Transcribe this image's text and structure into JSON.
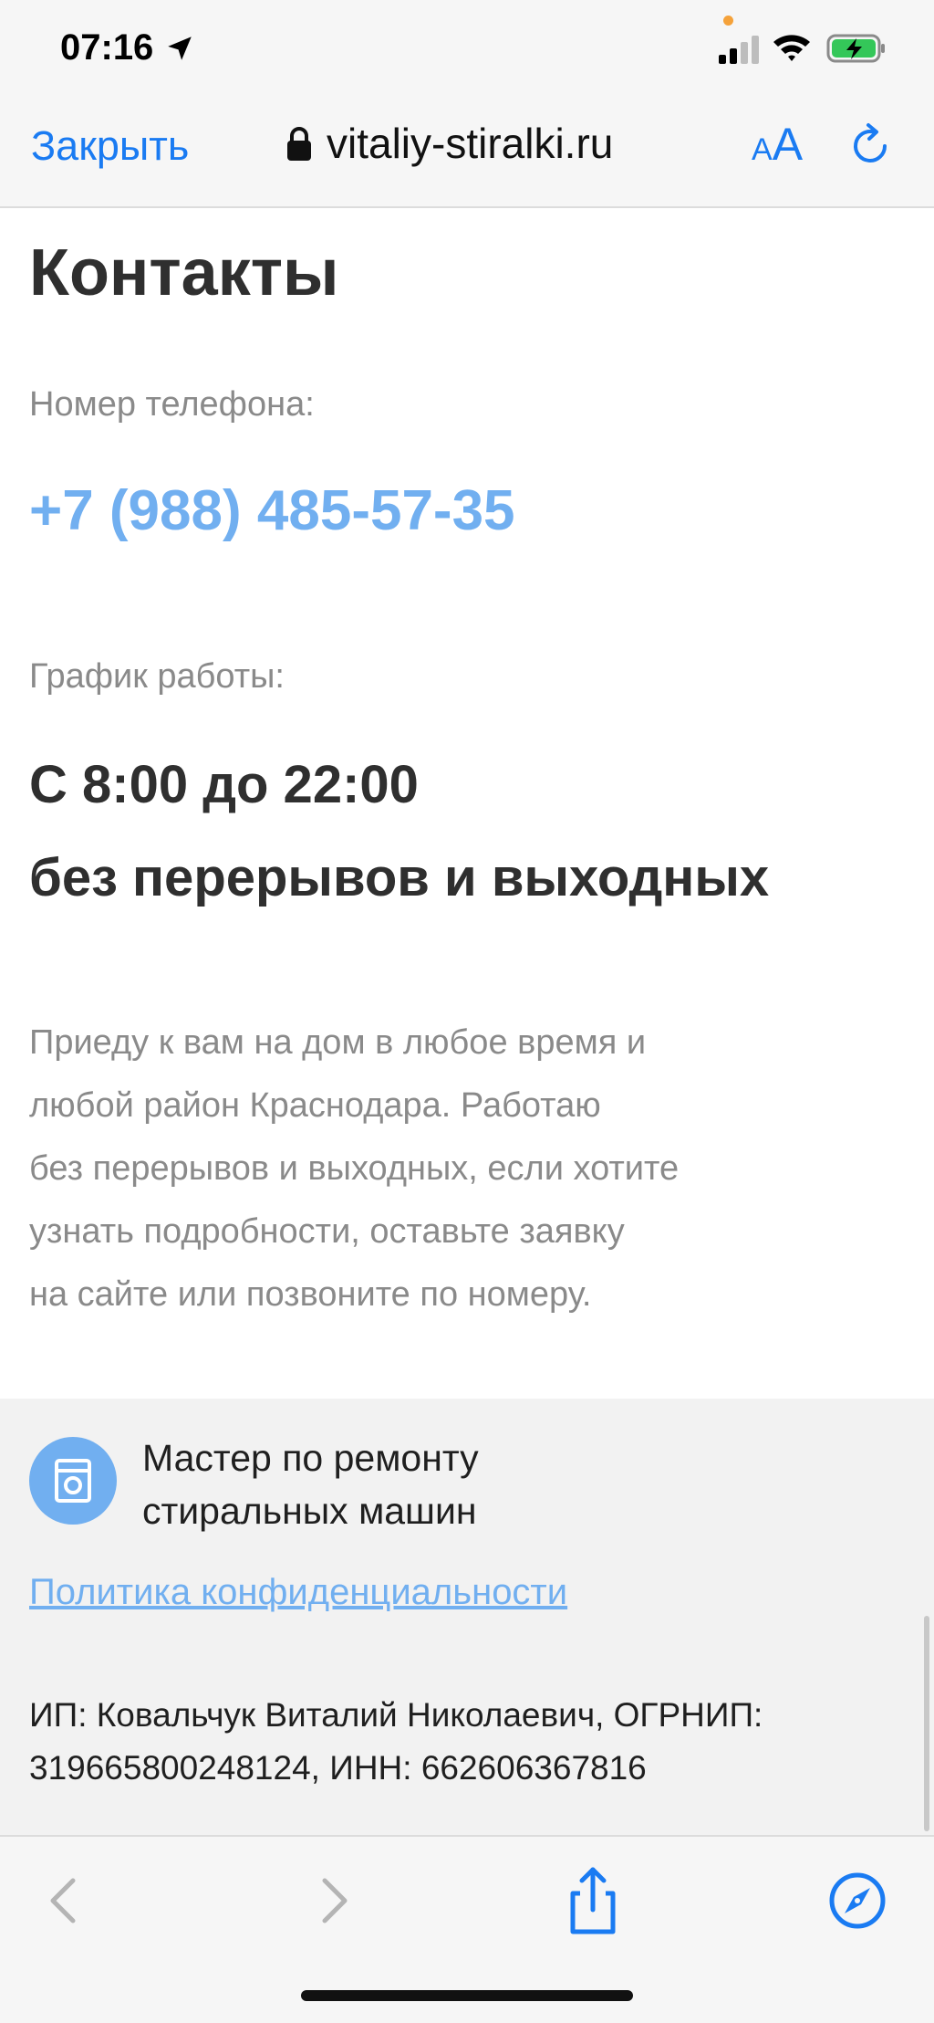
{
  "status_bar": {
    "time": "07:16"
  },
  "browser": {
    "close_label": "Закрыть",
    "url": "vitaliy-stiralki.ru",
    "text_size_small": "A",
    "text_size_large": "A"
  },
  "contacts": {
    "title": "Контакты",
    "phone_label": "Номер телефона:",
    "phone": "+7 (988) 485-57-35",
    "schedule_label": "График работы:",
    "hours_line1": "С 8:00 до 22:00",
    "hours_line2": "без перерывов и выходных",
    "description_lines": [
      "Приеду к вам на дом в любое время и",
      "любой район Краснодара. Работаю",
      "без перерывов и выходных, если хотите",
      "узнать подробности, оставьте заявку",
      "на сайте или позвоните по номеру."
    ]
  },
  "footer": {
    "brand_line1": "Мастер по ремонту",
    "brand_line2": "стиральных машин",
    "privacy_link": "Политика конфиденциальности",
    "legal_line1": "ИП: Ковальчук Виталий Николаевич, ОГРНИП:",
    "legal_line2": "319665800248124, ИНН: 662606367816"
  },
  "colors": {
    "ios_blue": "#1a7bf2",
    "site_accent": "#71aff0",
    "text_dark": "#2f2f2f",
    "text_gray": "#8a8a8a"
  }
}
